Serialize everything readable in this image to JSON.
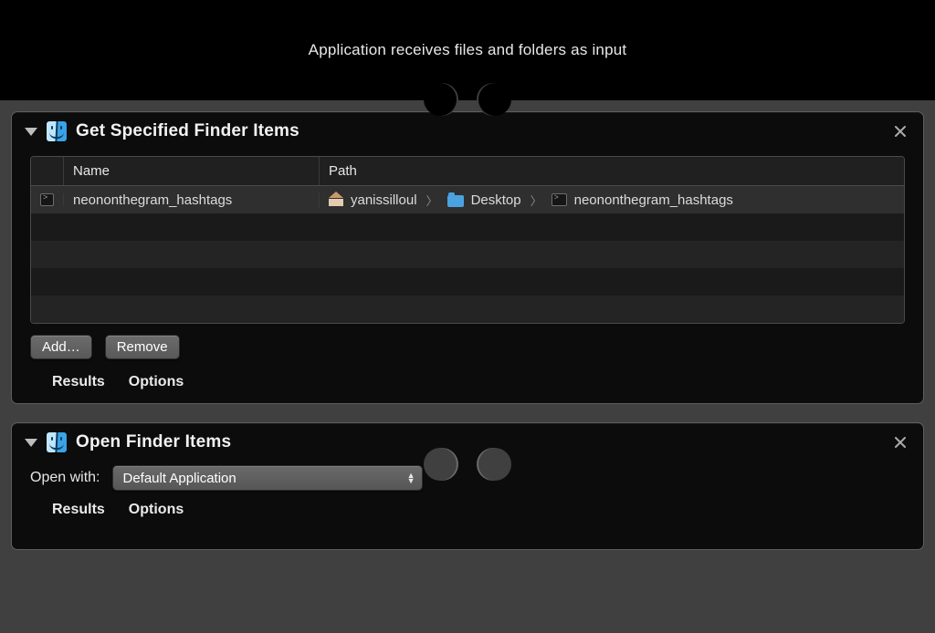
{
  "header": {
    "subtitle": "Application receives files and folders as input"
  },
  "actions": [
    {
      "id": "get-specified-finder-items",
      "title": "Get Specified Finder Items",
      "columns": {
        "name": "Name",
        "path": "Path"
      },
      "rows": [
        {
          "icon": "terminal-icon",
          "name": "neononthegram_hashtags",
          "path_segments": [
            {
              "icon": "home-icon",
              "label": "yanissilloul"
            },
            {
              "icon": "folder-icon",
              "label": "Desktop"
            },
            {
              "icon": "terminal-icon",
              "label": "neononthegram_hashtags"
            }
          ]
        }
      ],
      "buttons": {
        "add": "Add…",
        "remove": "Remove"
      },
      "footer": {
        "results": "Results",
        "options": "Options"
      }
    },
    {
      "id": "open-finder-items",
      "title": "Open Finder Items",
      "open_with_label": "Open with:",
      "open_with_value": "Default Application",
      "footer": {
        "results": "Results",
        "options": "Options"
      }
    }
  ]
}
